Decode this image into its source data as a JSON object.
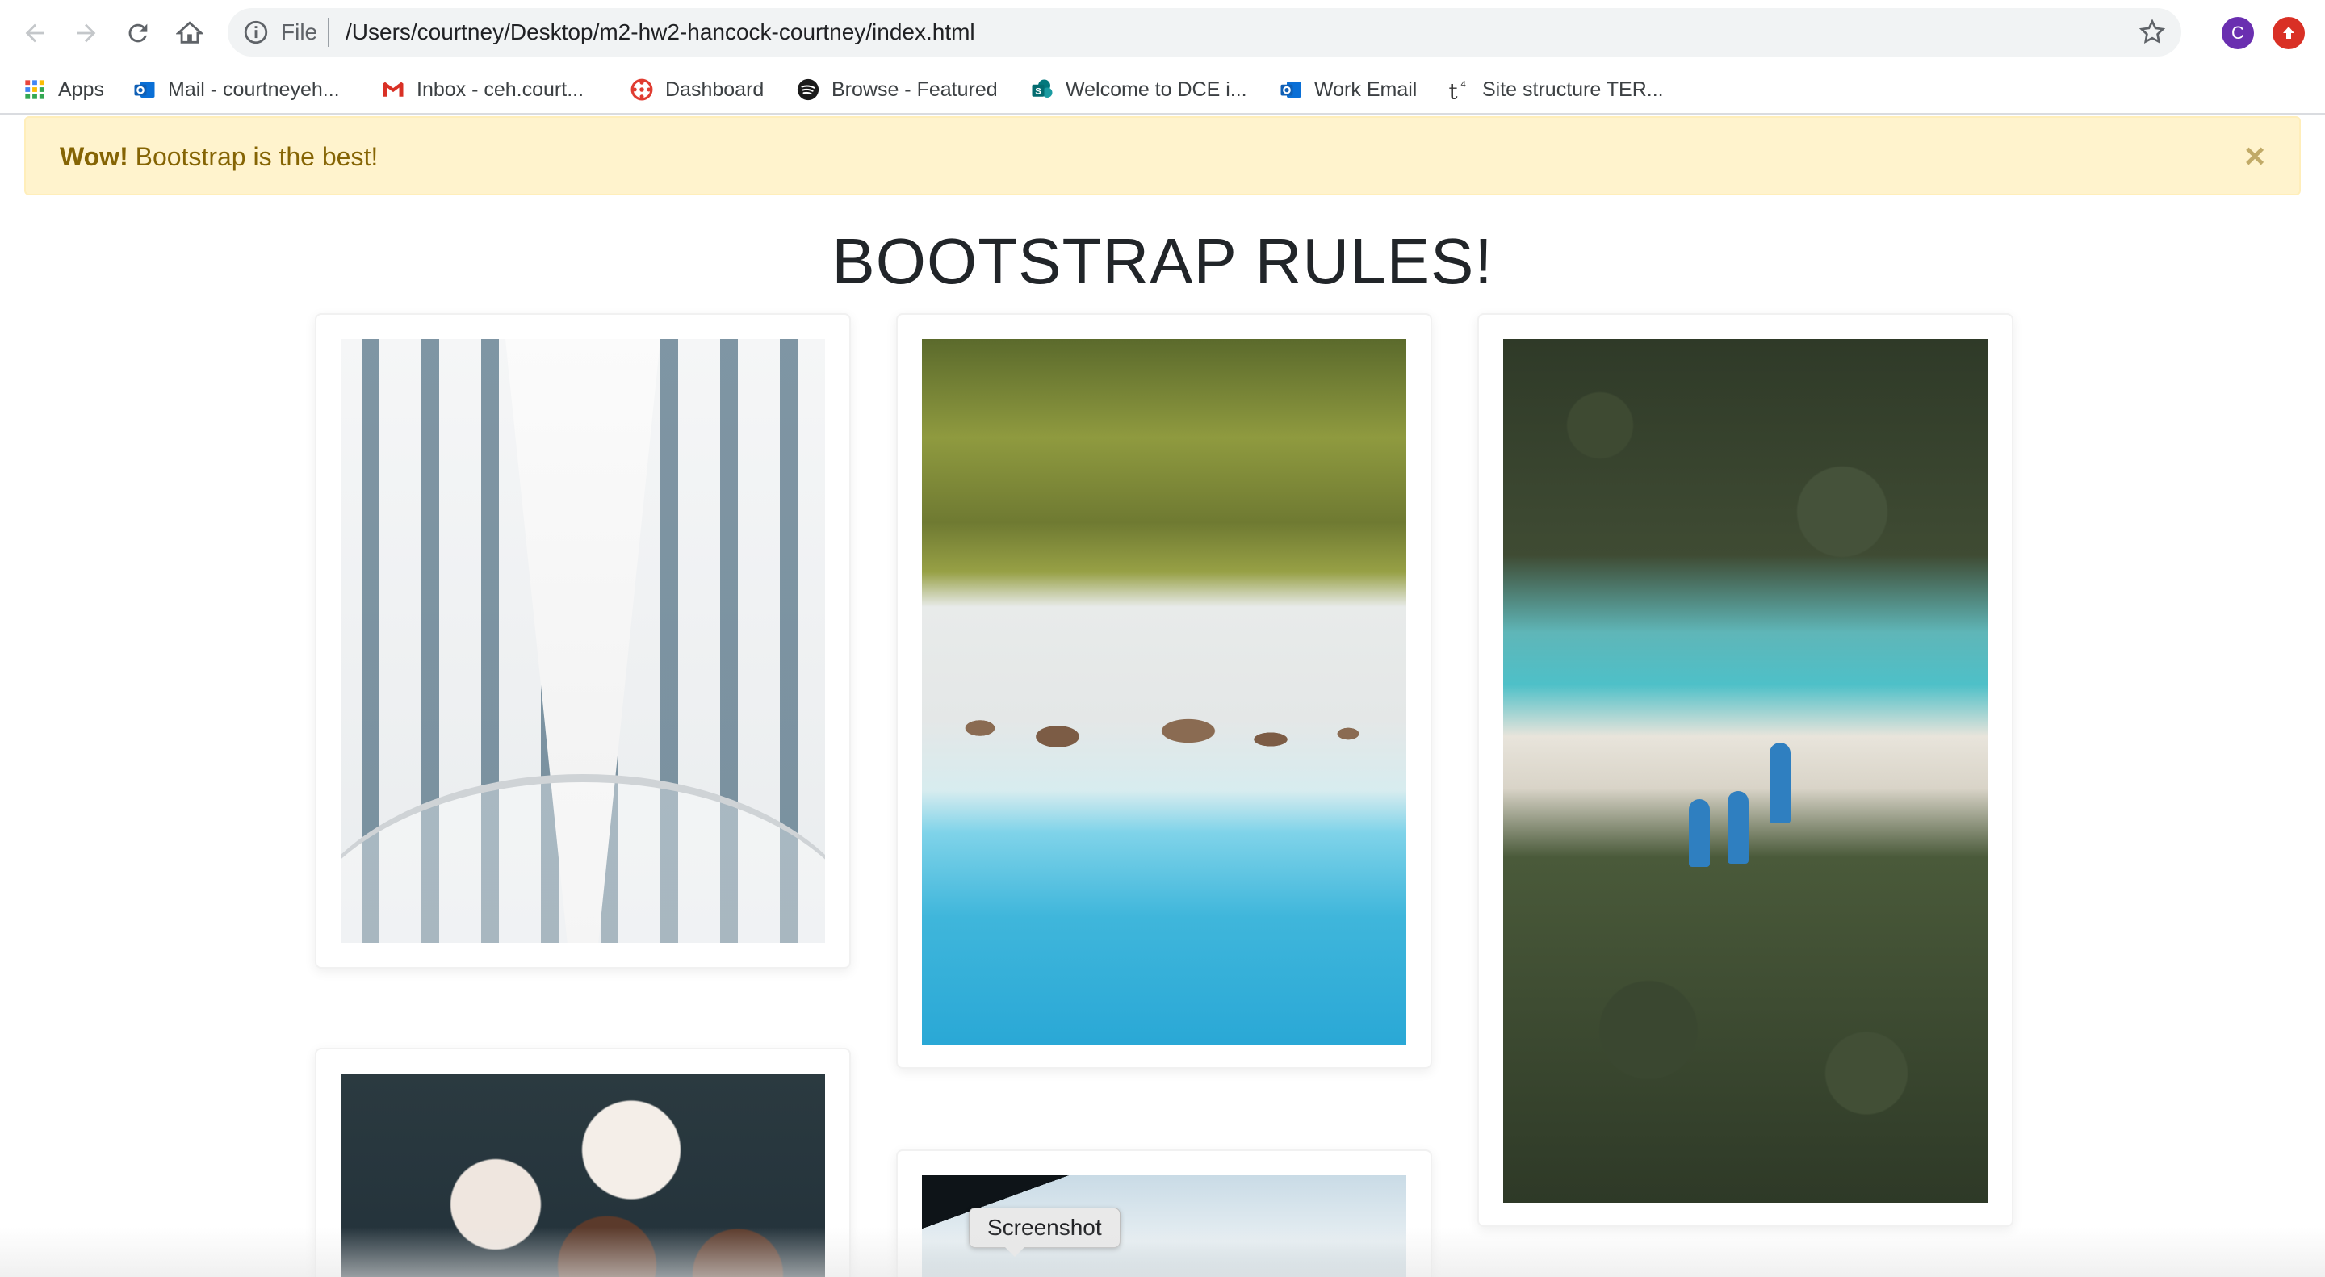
{
  "browser": {
    "url_scheme": "File",
    "url": "/Users/courtney/Desktop/m2-hw2-hancock-courtney/index.html",
    "profile_initial": "C",
    "bookmarks": [
      {
        "label": "Apps",
        "icon": "apps-grid-icon"
      },
      {
        "label": "Mail - courtneyeh...",
        "icon": "outlook-icon"
      },
      {
        "label": "Inbox - ceh.court...",
        "icon": "gmail-icon"
      },
      {
        "label": "Dashboard",
        "icon": "dashboard-icon"
      },
      {
        "label": "Browse - Featured",
        "icon": "spotify-icon"
      },
      {
        "label": "Welcome to DCE i...",
        "icon": "sharepoint-icon"
      },
      {
        "label": "Work Email",
        "icon": "outlook-icon"
      },
      {
        "label": "Site structure TER...",
        "icon": "t4-icon"
      }
    ]
  },
  "alert": {
    "strong": "Wow!",
    "text": " Bootstrap is the best!",
    "close": "×"
  },
  "page": {
    "heading": "BOOTSTRAP RULES!"
  },
  "tooltip": "Screenshot",
  "colors": {
    "alert_bg": "#fff3cd",
    "alert_text": "#856404",
    "profile": "#6a2fb0",
    "update": "#d93025"
  }
}
